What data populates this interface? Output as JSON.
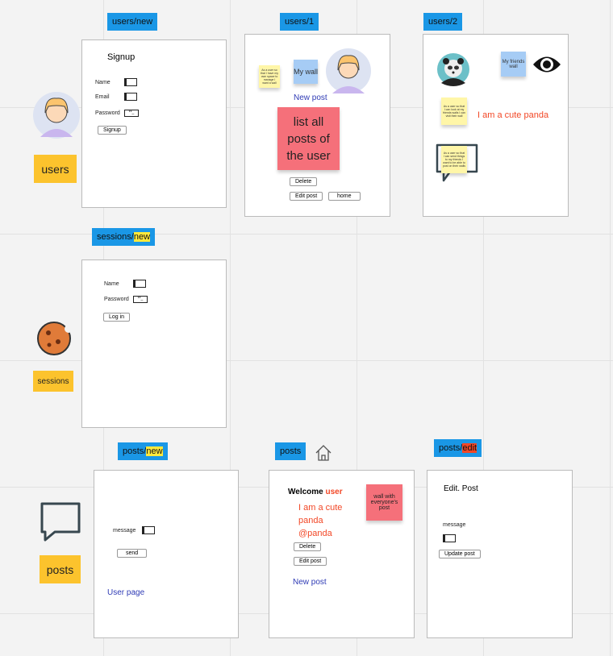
{
  "labels": {
    "users": "users",
    "sessions": "sessions",
    "posts": "posts"
  },
  "users_new": {
    "tag": "users/new",
    "title": "Signup",
    "name": "Name",
    "email": "Email",
    "password": "Password",
    "pw_mask": "**_",
    "button": "Signup"
  },
  "users_1": {
    "tag": "users/1",
    "sticky": "As a user so that I have my own space to manage I want a wall",
    "my_wall": "My wall",
    "new_post": "New post",
    "big_sticky": "list all posts of the user",
    "delete": "Delete",
    "edit_post": "Edit post",
    "home": "home"
  },
  "users_2": {
    "tag": "users/2",
    "friends_wall": "My friends wall",
    "sticky": "As a user so that I can look at my friends walls I can visit their wall",
    "bio": "I am a cute panda",
    "sticky2": "As a user so that I can send things to my friends I want to be able to post on their walls"
  },
  "sessions_new": {
    "tag_a": "sessions/",
    "tag_b": "new",
    "name": "Name",
    "password": "Password",
    "pw_mask": "**_",
    "button": "Log in"
  },
  "posts_new": {
    "tag_a": "posts/",
    "tag_b": "new",
    "message": "message",
    "send": "send",
    "user_page": "User page"
  },
  "posts": {
    "tag": "posts",
    "welcome": "Welcome ",
    "user": "user",
    "post_text": "I am a cute panda @panda",
    "sticky": "wall with everyone's post",
    "delete": "Delete",
    "edit_post": "Edit post",
    "new_post": "New post"
  },
  "posts_edit": {
    "tag_a": "posts/",
    "tag_b": "edit",
    "title": "Edit. Post",
    "message": "message",
    "button": "Update post"
  },
  "colors": {
    "tag": "#1a97e6",
    "label": "#fcc32d",
    "accent_red": "#f24726",
    "link": "#2f3bb5"
  }
}
